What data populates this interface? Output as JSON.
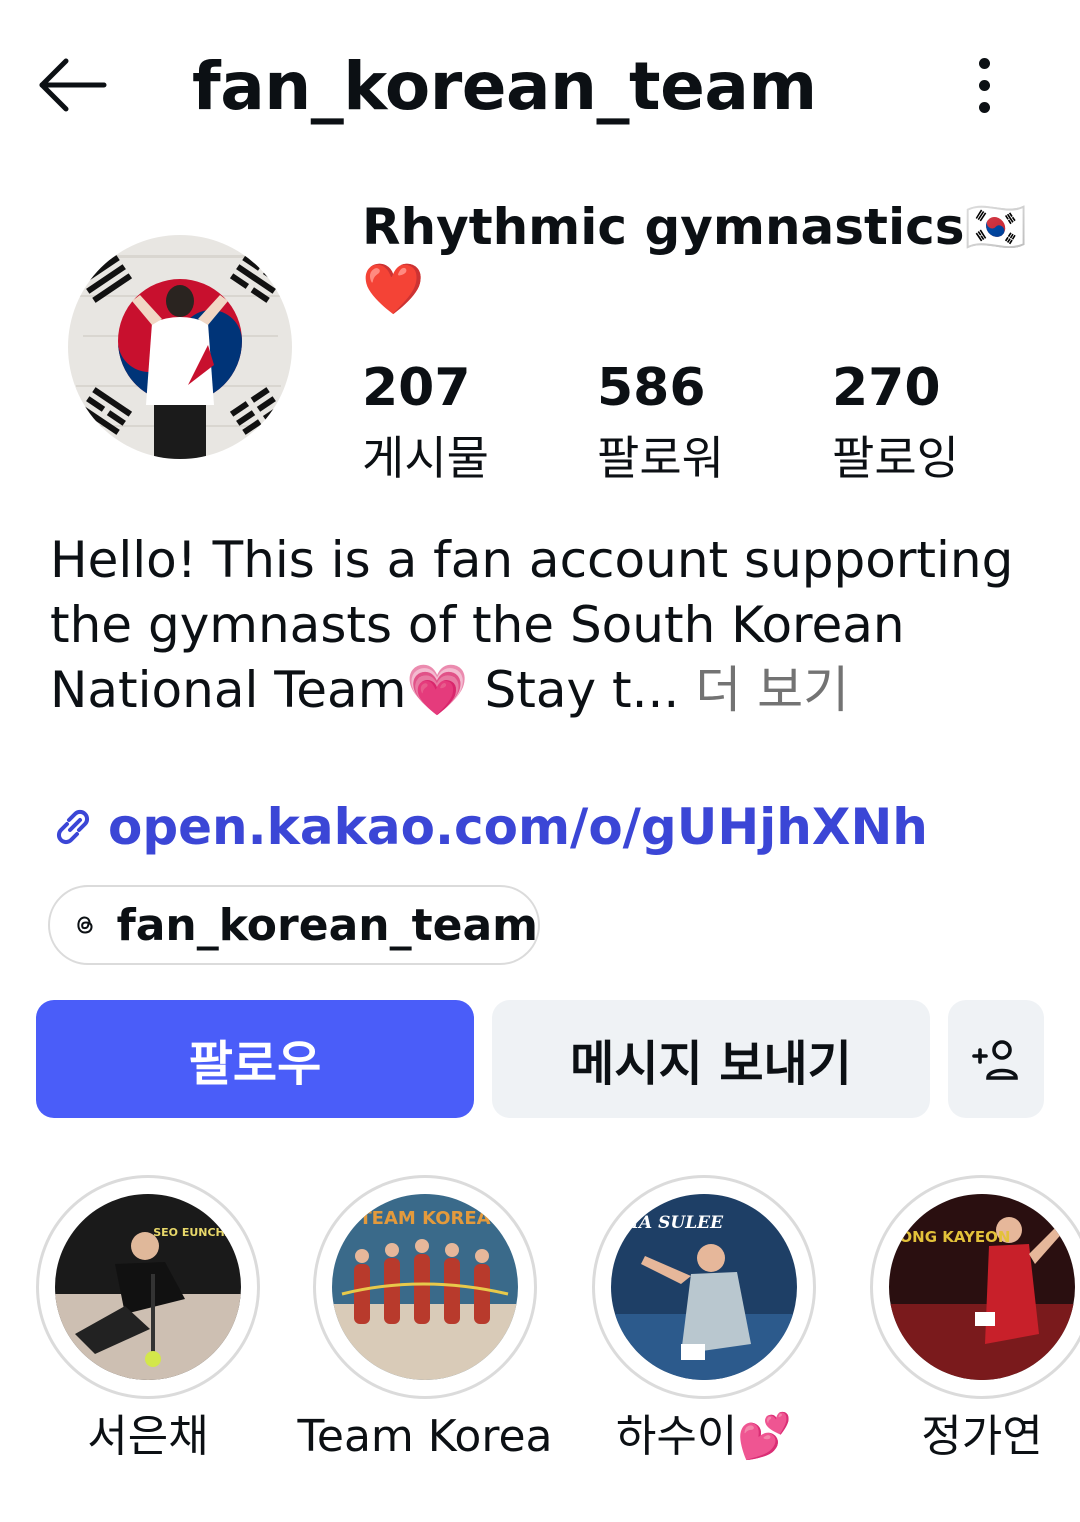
{
  "header": {
    "title": "fan_korean_team"
  },
  "profile": {
    "name_line1": "Rhythmic gymnastics🇰🇷",
    "name_line2": "❤️",
    "stats": [
      {
        "value": "207",
        "label": "게시물"
      },
      {
        "value": "586",
        "label": "팔로워"
      },
      {
        "value": "270",
        "label": "팔로잉"
      }
    ]
  },
  "bio": {
    "text": "Hello! This is a fan account supporting the gymnasts of the South Korean National Team💗 Stay t...",
    "more": "더 보기"
  },
  "link": {
    "text": "open.kakao.com/o/gUHjhXNh"
  },
  "threads": {
    "handle": "fan_korean_team"
  },
  "actions": {
    "follow": "팔로우",
    "message": "메시지 보내기",
    "add_user": "+옹"
  },
  "highlights": [
    {
      "label": "서은채",
      "overlay": "SEO EUNCHAE"
    },
    {
      "label": "Team Korea",
      "overlay": "TEAM KOREA"
    },
    {
      "label": "하수이💕",
      "overlay": "HA SULEE"
    },
    {
      "label": "정가연",
      "overlay": "JEONG KAYEON"
    }
  ],
  "colors": {
    "accent": "#4a5df9",
    "link": "#3b46d6",
    "secondary_bg": "#eff2f5",
    "muted_text": "#737373"
  }
}
